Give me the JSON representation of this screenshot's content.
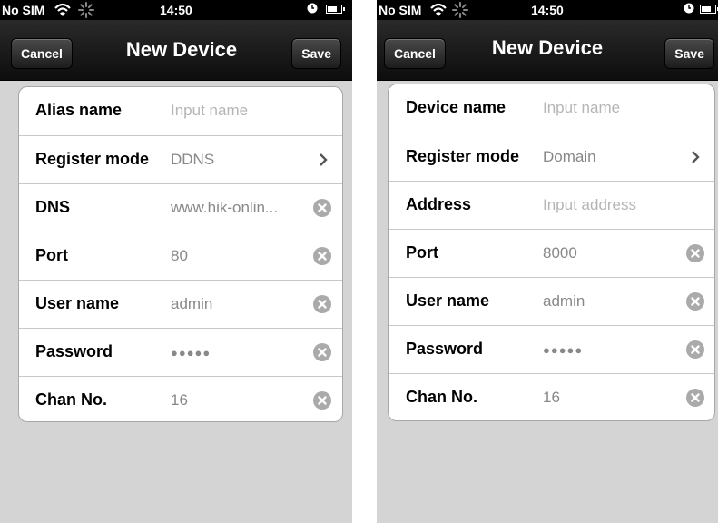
{
  "screens": [
    {
      "status": {
        "carrier": "No SIM",
        "time": "14:50"
      },
      "nav": {
        "cancel": "Cancel",
        "title": "New Device",
        "save": "Save"
      },
      "rows": [
        {
          "label": "Alias name",
          "value": "Input name",
          "placeholder": true,
          "accessory": "none"
        },
        {
          "label": "Register mode",
          "value": "DDNS",
          "placeholder": false,
          "accessory": "chevron"
        },
        {
          "label": "DNS",
          "value": "www.hik-onlin...",
          "placeholder": false,
          "accessory": "clear"
        },
        {
          "label": "Port",
          "value": "80",
          "placeholder": false,
          "accessory": "clear"
        },
        {
          "label": "User name",
          "value": "admin",
          "placeholder": false,
          "accessory": "clear"
        },
        {
          "label": "Password",
          "value": "●●●●●",
          "placeholder": false,
          "accessory": "clear"
        },
        {
          "label": "Chan No.",
          "value": "16",
          "placeholder": false,
          "accessory": "clear"
        }
      ]
    },
    {
      "status": {
        "carrier": "No SIM",
        "time": "14:50"
      },
      "nav": {
        "cancel": "Cancel",
        "title": "New Device",
        "save": "Save"
      },
      "rows": [
        {
          "label": "Device name",
          "value": "Input name",
          "placeholder": true,
          "accessory": "none"
        },
        {
          "label": "Register mode",
          "value": "Domain",
          "placeholder": false,
          "accessory": "chevron"
        },
        {
          "label": "Address",
          "value": "Input address",
          "placeholder": true,
          "accessory": "none"
        },
        {
          "label": "Port",
          "value": "8000",
          "placeholder": false,
          "accessory": "clear"
        },
        {
          "label": "User name",
          "value": "admin",
          "placeholder": false,
          "accessory": "clear"
        },
        {
          "label": "Password",
          "value": "●●●●●",
          "placeholder": false,
          "accessory": "clear"
        },
        {
          "label": "Chan No.",
          "value": "16",
          "placeholder": false,
          "accessory": "clear"
        }
      ]
    }
  ],
  "colors": {
    "screen_bg": "#d4d4d4",
    "nav_bg": "#1a1a1a",
    "placeholder_text": "#b5b5b5",
    "value_text": "#888888",
    "clear_icon": "#aaaaaa"
  }
}
